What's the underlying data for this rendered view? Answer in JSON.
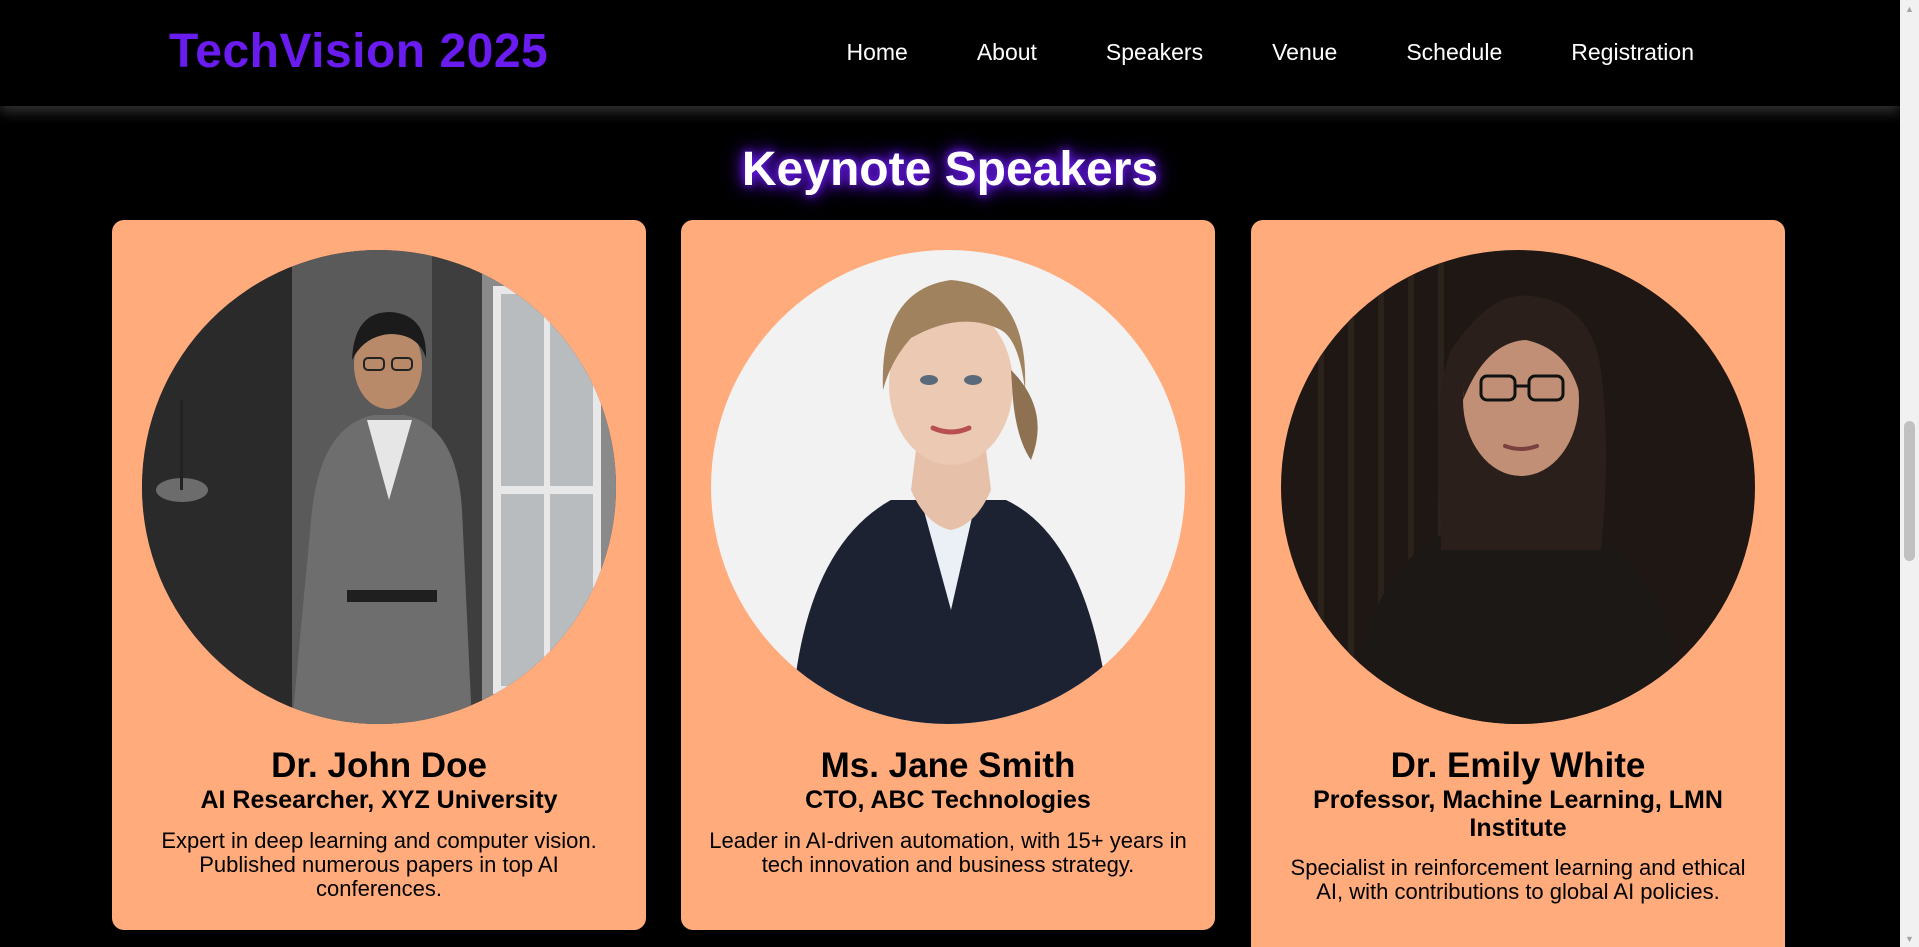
{
  "header": {
    "brand": "TechVision 2025",
    "nav": [
      "Home",
      "About",
      "Speakers",
      "Venue",
      "Schedule",
      "Registration"
    ]
  },
  "section": {
    "title": "Keynote Speakers"
  },
  "speakers": [
    {
      "name": "Dr. John Doe",
      "role": "AI Researcher, XYZ University",
      "bio": "Expert in deep learning and computer vision. Published numerous papers in top AI conferences.",
      "photo_icon": "speaker-photo-man-in-grey-suit"
    },
    {
      "name": "Ms. Jane Smith",
      "role": "CTO, ABC Technologies",
      "bio": "Leader in AI-driven automation, with 15+ years in tech innovation and business strategy.",
      "photo_icon": "speaker-photo-woman-in-navy-blazer"
    },
    {
      "name": "Dr. Emily White",
      "role": "Professor, Machine Learning, LMN Institute",
      "bio": "Specialist in reinforcement learning and ethical AI, with contributions to global AI policies.",
      "photo_icon": "speaker-photo-woman-with-glasses"
    }
  ],
  "colors": {
    "brand": "#6a1bf0",
    "card_background": "#ffab7c",
    "page_background": "#000000"
  },
  "scrollbar": {
    "position_fraction": 0.45
  }
}
